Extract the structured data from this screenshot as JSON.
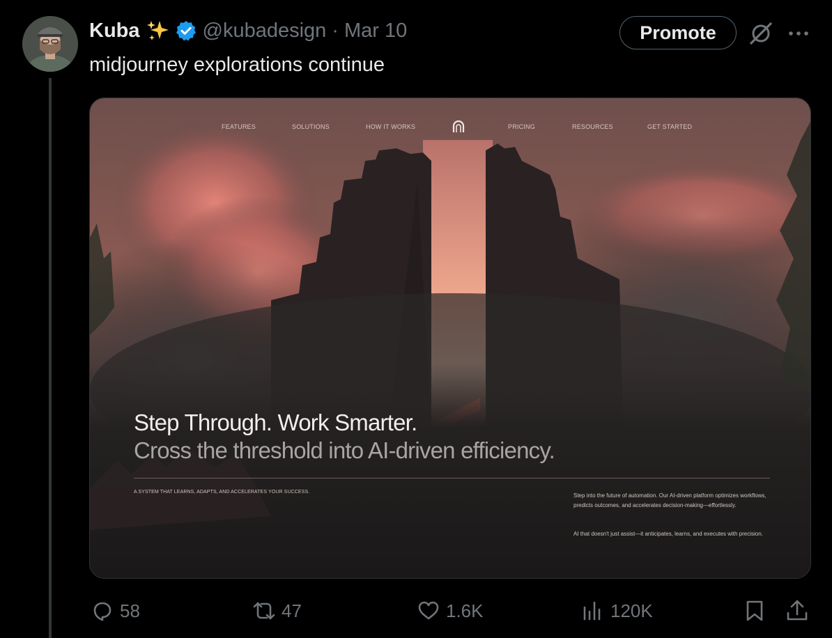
{
  "author": {
    "name": "Kuba",
    "handle": "@kubadesign",
    "separator": "·",
    "date": "Mar 10",
    "sparkle_icon": "sparkles-emoji",
    "verified_icon": "verified-badge-icon"
  },
  "header": {
    "promote_label": "Promote",
    "grok_icon": "grok-icon",
    "more_icon": "more-dots-icon"
  },
  "tweet": {
    "text": "midjourney explorations continue"
  },
  "media": {
    "nav": [
      "FEATURES",
      "SOLUTIONS",
      "HOW IT WORKS",
      "PRICING",
      "RESOURCES",
      "GET STARTED"
    ],
    "headline": "Step Through. Work Smarter.",
    "subhead": "Cross the threshold into AI-driven efficiency.",
    "tagline": "A SYSTEM THAT LEARNS, ADAPTS, AND ACCELERATES YOUR SUCCESS.",
    "paragraph1": "Step into the future of automation. Our AI-driven platform optimizes workflows, predicts outcomes, and accelerates decision-making—effortlessly.",
    "paragraph2": "AI that doesn't just assist—it anticipates, learns, and executes with precision."
  },
  "actions": {
    "replies": "58",
    "reposts": "47",
    "likes": "1.6K",
    "views": "120K"
  },
  "colors": {
    "background": "#000000",
    "text": "#e7e9ea",
    "muted": "#71767b",
    "verified": "#1d9bf0",
    "glow": "#f2a184"
  }
}
